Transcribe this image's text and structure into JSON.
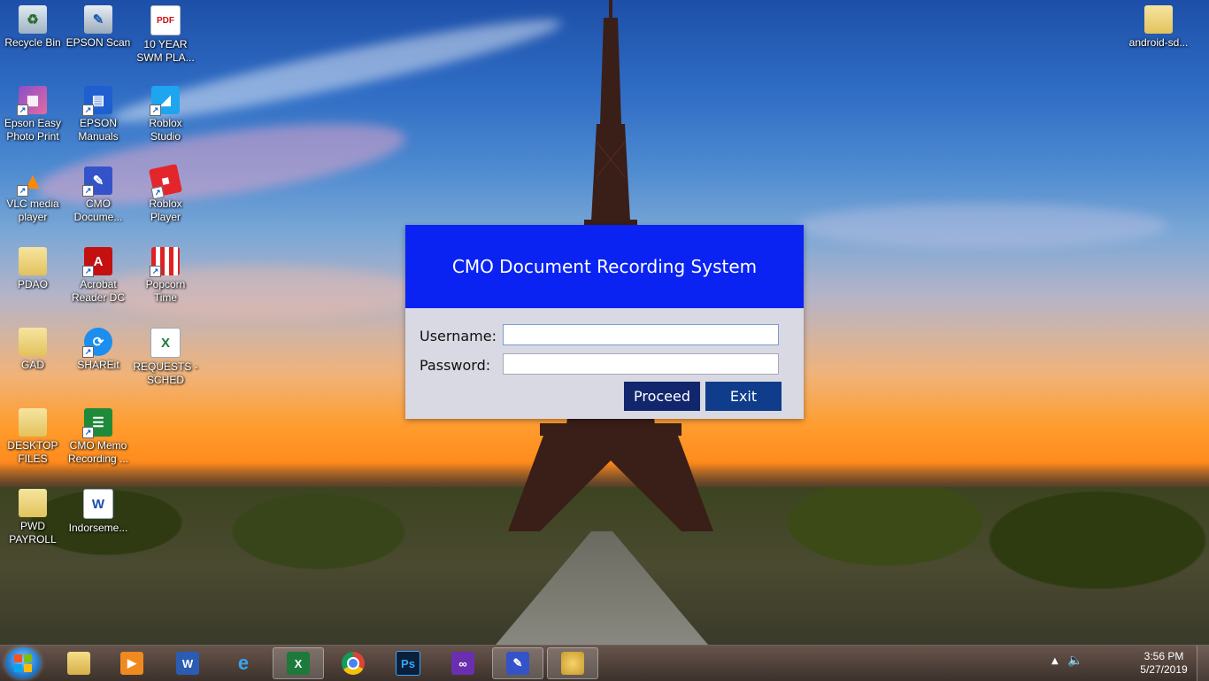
{
  "desktop": {
    "icons": [
      {
        "label": "Recycle Bin",
        "icon": "recycle-bin-icon"
      },
      {
        "label": "EPSON Scan",
        "icon": "epson-scan-icon"
      },
      {
        "label": "10 YEAR SWM PLA...",
        "icon": "pdf-file-icon"
      },
      {
        "label": "Epson Easy Photo Print",
        "icon": "epson-photo-icon"
      },
      {
        "label": "EPSON Manuals",
        "icon": "epson-manuals-icon"
      },
      {
        "label": "Roblox Studio",
        "icon": "roblox-studio-icon"
      },
      {
        "label": "VLC media player",
        "icon": "vlc-icon"
      },
      {
        "label": "CMO Docume...",
        "icon": "cmo-app-icon"
      },
      {
        "label": "Roblox Player",
        "icon": "roblox-player-icon"
      },
      {
        "label": "PDAO",
        "icon": "folder-icon"
      },
      {
        "label": "Acrobat Reader DC",
        "icon": "acrobat-icon"
      },
      {
        "label": "Popcorn Time",
        "icon": "popcorn-icon"
      },
      {
        "label": "GAD",
        "icon": "folder-icon"
      },
      {
        "label": "SHAREit",
        "icon": "shareit-icon"
      },
      {
        "label": "REQUESTS - SCHED",
        "icon": "excel-file-icon"
      },
      {
        "label": "DESKTOP FILES",
        "icon": "folder-icon"
      },
      {
        "label": "CMO Memo Recording ...",
        "icon": "cmo-memo-icon"
      },
      {
        "label": "PWD PAYROLL",
        "icon": "folder-icon"
      },
      {
        "label": "Indorseme...",
        "icon": "word-file-icon"
      },
      {
        "label": "android-sd...",
        "icon": "folder-icon"
      }
    ]
  },
  "dialog": {
    "title": "CMO Document Recording System",
    "username_label": "Username:",
    "password_label": "Password:",
    "username_value": "",
    "password_value": "",
    "proceed_label": "Proceed",
    "exit_label": "Exit",
    "header_color": "#0a23f2",
    "button_color": "#12266e"
  },
  "taskbar": {
    "items": [
      {
        "icon": "file-explorer-icon"
      },
      {
        "icon": "media-player-icon"
      },
      {
        "icon": "word-icon"
      },
      {
        "icon": "internet-explorer-icon"
      },
      {
        "icon": "excel-icon"
      },
      {
        "icon": "chrome-icon"
      },
      {
        "icon": "photoshop-icon"
      },
      {
        "icon": "visual-studio-icon"
      },
      {
        "icon": "cmo-app-icon"
      },
      {
        "icon": "paint-icon"
      }
    ],
    "time": "3:56 PM",
    "date": "5/27/2019"
  }
}
